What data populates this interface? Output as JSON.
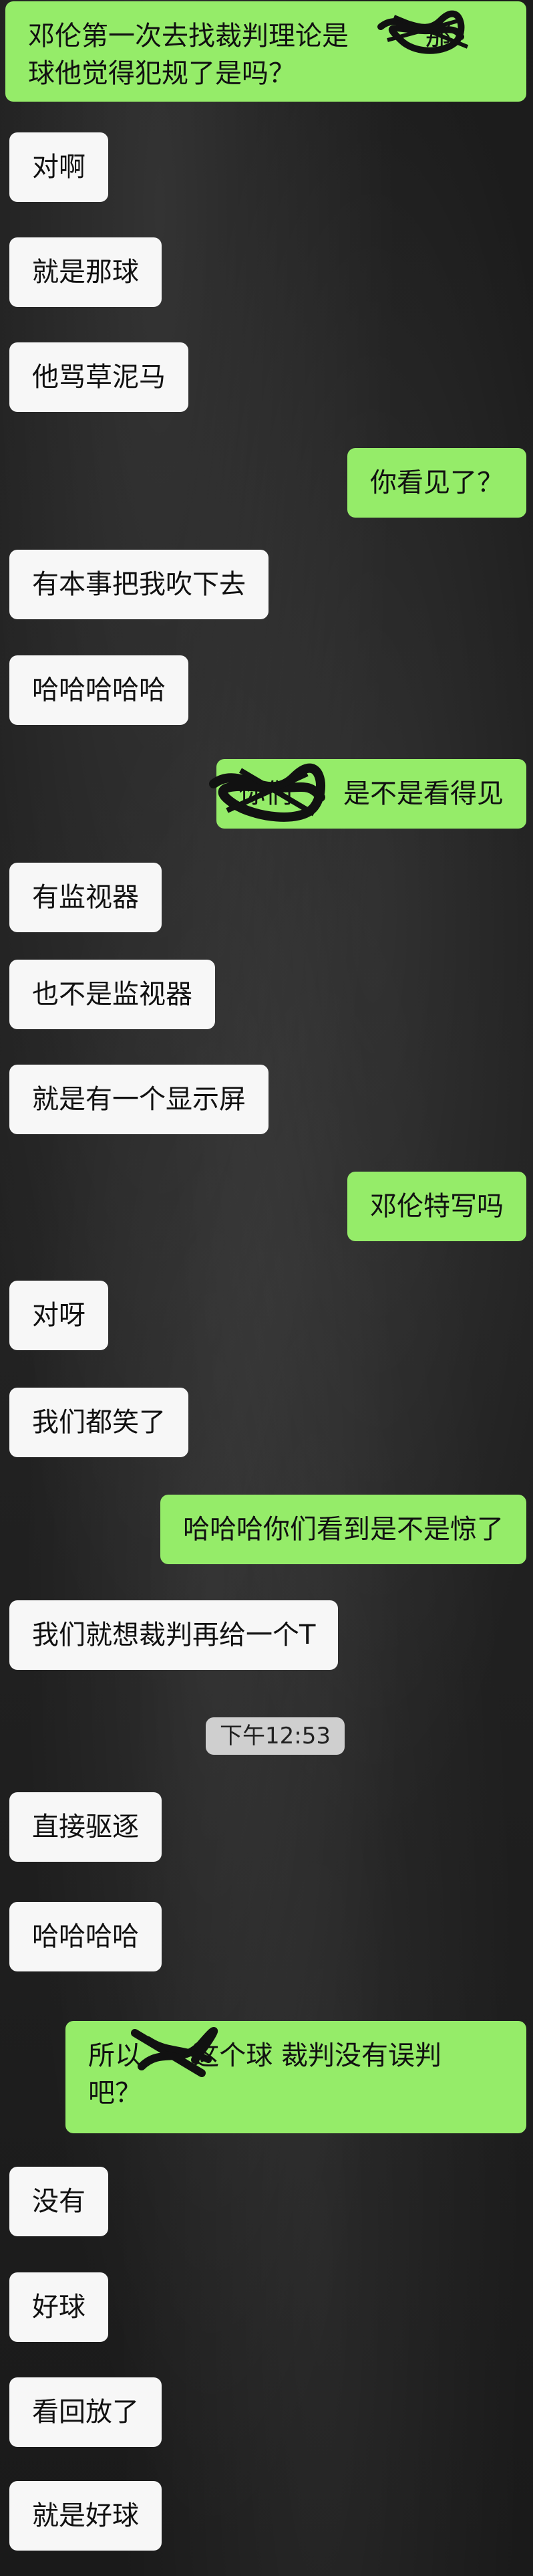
{
  "messages": [
    {
      "side": "out",
      "text": "邓伦第一次去找裁判理论是         那\n球他觉得犯规了是吗？"
    },
    {
      "side": "in",
      "text": "对啊"
    },
    {
      "side": "in",
      "text": "就是那球"
    },
    {
      "side": "in",
      "text": "他骂草泥马"
    },
    {
      "side": "out",
      "text": "你看见了？"
    },
    {
      "side": "in",
      "text": "有本事把我吹下去"
    },
    {
      "side": "in",
      "text": "哈哈哈哈哈"
    },
    {
      "side": "out",
      "text": "你们      是不是看得见"
    },
    {
      "side": "in",
      "text": "有监视器"
    },
    {
      "side": "in",
      "text": "也不是监视器"
    },
    {
      "side": "in",
      "text": "就是有一个显示屏"
    },
    {
      "side": "out",
      "text": "邓伦特写吗"
    },
    {
      "side": "in",
      "text": "对呀"
    },
    {
      "side": "in",
      "text": "我们都笑了"
    },
    {
      "side": "out",
      "text": "哈哈哈你们看到是不是惊了"
    },
    {
      "side": "in",
      "text": "我们就想裁判再给一个T"
    },
    {
      "side": "in",
      "text": "直接驱逐"
    },
    {
      "side": "in",
      "text": "哈哈哈哈"
    },
    {
      "side": "out",
      "text": "所以      这个球 裁判没有误判\n吧？"
    },
    {
      "side": "in",
      "text": "没有"
    },
    {
      "side": "in",
      "text": "好球"
    },
    {
      "side": "in",
      "text": "看回放了"
    },
    {
      "side": "in",
      "text": "就是好球"
    }
  ],
  "timestamp": "下午12:53",
  "colors": {
    "outgoing_bubble": "#95ec69",
    "incoming_bubble": "#f7f7f7",
    "background": "#1f1f1f"
  }
}
